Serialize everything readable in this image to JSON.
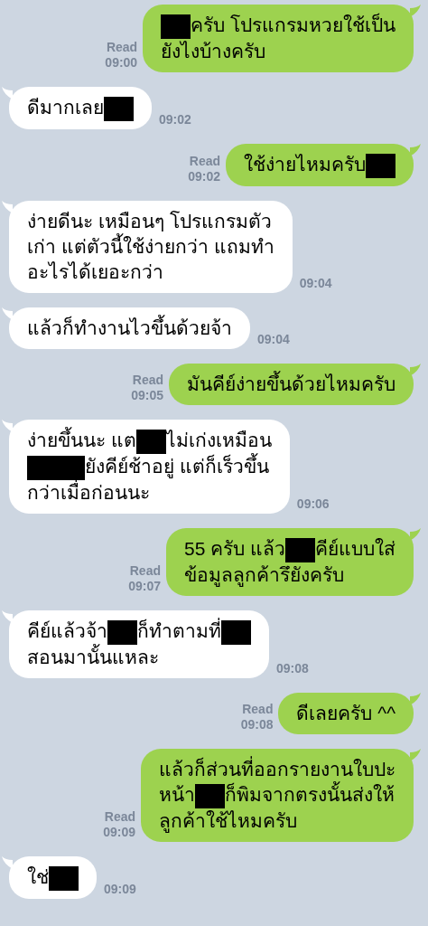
{
  "messages": [
    {
      "kind": "outgoing",
      "read": "Read",
      "time": "09:00",
      "lines": [
        [
          {
            "kind": "redacted"
          },
          {
            "kind": "text",
            "text": "ครับ โปรแกรมหวยใช้เป็น"
          }
        ],
        [
          {
            "kind": "text",
            "text": "ยังไงบ้างครับ"
          }
        ]
      ]
    },
    {
      "kind": "incoming",
      "time": "09:02",
      "lines": [
        [
          {
            "kind": "text",
            "text": "ดีมากเลย"
          },
          {
            "kind": "redacted"
          }
        ]
      ]
    },
    {
      "kind": "outgoing",
      "read": "Read",
      "time": "09:02",
      "lines": [
        [
          {
            "kind": "text",
            "text": "ใช้ง่ายไหมครับ"
          },
          {
            "kind": "redacted"
          }
        ]
      ]
    },
    {
      "kind": "incoming",
      "time": "09:04",
      "lines": [
        [
          {
            "kind": "text",
            "text": "ง่ายดีนะ เหมือนๆ โปรแกรมตัว"
          }
        ],
        [
          {
            "kind": "text",
            "text": "เก่า แต่ตัวนี้ใช้ง่ายกว่า แถมทำ"
          }
        ],
        [
          {
            "kind": "text",
            "text": "อะไรได้เยอะกว่า"
          }
        ]
      ]
    },
    {
      "kind": "incoming",
      "time": "09:04",
      "lines": [
        [
          {
            "kind": "text",
            "text": "แล้วก็ทำงานไวขึ้นด้วยจ้า"
          }
        ]
      ]
    },
    {
      "kind": "outgoing",
      "read": "Read",
      "time": "09:05",
      "lines": [
        [
          {
            "kind": "text",
            "text": "มันคีย์ง่ายขึ้นด้วยไหมครับ"
          }
        ]
      ]
    },
    {
      "kind": "incoming",
      "time": "09:06",
      "lines": [
        [
          {
            "kind": "text",
            "text": "ง่ายขึ้นนะ แต"
          },
          {
            "kind": "redacted"
          },
          {
            "kind": "text",
            "text": "ไม่เก่งเหมือน"
          }
        ],
        [
          {
            "kind": "redacted_long"
          },
          {
            "kind": "text",
            "text": "ยังคีย์ช้าอยู่ แต่ก็เร็วขึ้น"
          }
        ],
        [
          {
            "kind": "text",
            "text": "กว่าเมื่อก่อนนะ"
          }
        ]
      ]
    },
    {
      "kind": "outgoing",
      "read": "Read",
      "time": "09:07",
      "lines": [
        [
          {
            "kind": "text",
            "text": "55 ครับ แล้ว"
          },
          {
            "kind": "redacted"
          },
          {
            "kind": "text",
            "text": "คีย์แบบใส่"
          }
        ],
        [
          {
            "kind": "text",
            "text": "ข้อมูลลูกค้ารึยังครับ"
          }
        ]
      ]
    },
    {
      "kind": "incoming",
      "time": "09:08",
      "lines": [
        [
          {
            "kind": "text",
            "text": "คีย์แล้วจ้า"
          },
          {
            "kind": "redacted"
          },
          {
            "kind": "text",
            "text": "ก็ทำตามที่"
          },
          {
            "kind": "redacted"
          }
        ],
        [
          {
            "kind": "text",
            "text": "สอนมานั้นแหละ"
          }
        ]
      ]
    },
    {
      "kind": "outgoing",
      "read": "Read",
      "time": "09:08",
      "lines": [
        [
          {
            "kind": "text",
            "text": "ดีเลยครับ ^^"
          }
        ]
      ]
    },
    {
      "kind": "outgoing",
      "read": "Read",
      "time": "09:09",
      "lines": [
        [
          {
            "kind": "text",
            "text": "แล้วก็ส่วนที่ออกรายงานใบปะ"
          }
        ],
        [
          {
            "kind": "text",
            "text": "หน้า"
          },
          {
            "kind": "redacted"
          },
          {
            "kind": "text",
            "text": "ก็พิมจากตรงนั้นส่งให้"
          }
        ],
        [
          {
            "kind": "text",
            "text": "ลูกค้าใช้ไหมครับ"
          }
        ]
      ]
    },
    {
      "kind": "incoming",
      "time": "09:09",
      "lines": [
        [
          {
            "kind": "text",
            "text": "ใช่"
          },
          {
            "kind": "redacted"
          }
        ]
      ]
    }
  ]
}
